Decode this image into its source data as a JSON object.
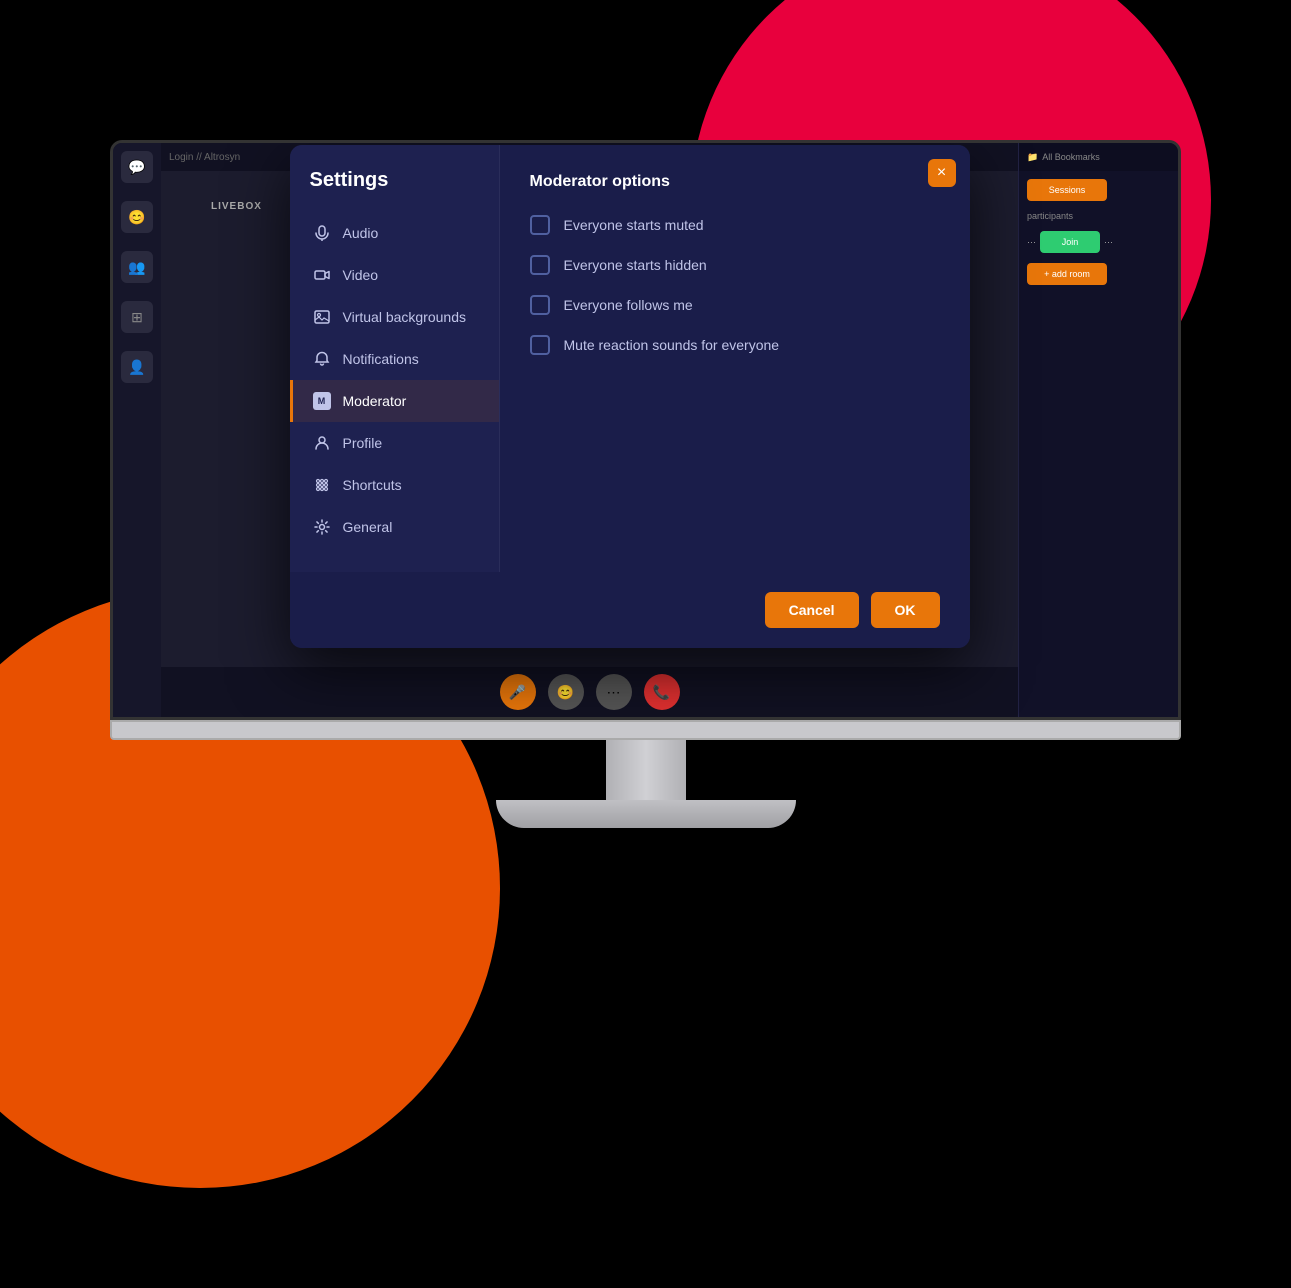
{
  "background": {
    "red_circle_color": "#e8003d",
    "orange_circle_color": "#e85000",
    "bg_color": "#000000"
  },
  "modal": {
    "title": "Settings",
    "close_button_label": "×",
    "nav_items": [
      {
        "id": "audio",
        "label": "Audio",
        "icon": "🔊",
        "active": false
      },
      {
        "id": "video",
        "label": "Video",
        "icon": "📹",
        "active": false
      },
      {
        "id": "virtual-backgrounds",
        "label": "Virtual backgrounds",
        "icon": "🖼",
        "active": false
      },
      {
        "id": "notifications",
        "label": "Notifications",
        "icon": "🔔",
        "active": false
      },
      {
        "id": "moderator",
        "label": "Moderator",
        "icon": "M",
        "active": true
      },
      {
        "id": "profile",
        "label": "Profile",
        "icon": "👤",
        "active": false
      },
      {
        "id": "shortcuts",
        "label": "Shortcuts",
        "icon": "⌨",
        "active": false
      },
      {
        "id": "general",
        "label": "General",
        "icon": "⚙",
        "active": false
      }
    ],
    "content": {
      "section_title": "Moderator options",
      "options": [
        {
          "id": "starts-muted",
          "label": "Everyone starts muted",
          "checked": false
        },
        {
          "id": "starts-hidden",
          "label": "Everyone starts hidden",
          "checked": false
        },
        {
          "id": "follows-me",
          "label": "Everyone follows me",
          "checked": false
        },
        {
          "id": "mute-reactions",
          "label": "Mute reaction sounds for everyone",
          "checked": false
        }
      ]
    },
    "footer": {
      "cancel_label": "Cancel",
      "ok_label": "OK"
    }
  },
  "app": {
    "livebox_label": "LIVEBOX",
    "topbar_text": "Login // Altrosyn",
    "bookmarks_label": "All Bookmarks"
  }
}
